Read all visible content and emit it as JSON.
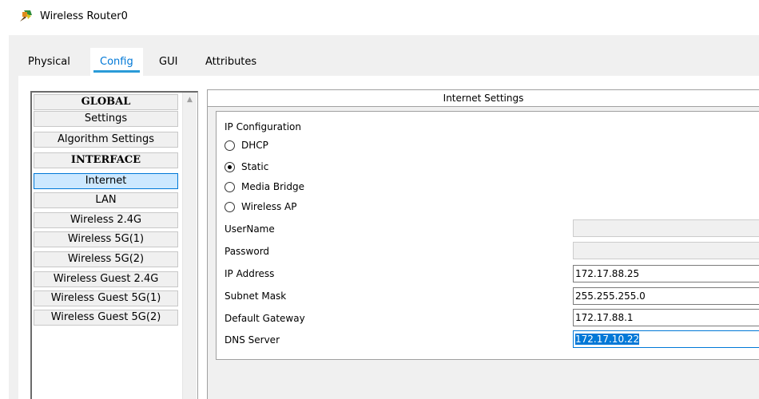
{
  "window": {
    "title": "Wireless Router0",
    "icon": "router-icon"
  },
  "tabs": [
    {
      "label": "Physical",
      "active": false
    },
    {
      "label": "Config",
      "active": true
    },
    {
      "label": "GUI",
      "active": false
    },
    {
      "label": "Attributes",
      "active": false
    }
  ],
  "nav": {
    "items": [
      {
        "label": "GLOBAL",
        "type": "header"
      },
      {
        "label": "Settings",
        "type": "item"
      },
      {
        "label": "Algorithm Settings",
        "type": "item"
      },
      {
        "label": "INTERFACE",
        "type": "header"
      },
      {
        "label": "Internet",
        "type": "item",
        "selected": true
      },
      {
        "label": "LAN",
        "type": "item"
      },
      {
        "label": "Wireless 2.4G",
        "type": "item"
      },
      {
        "label": "Wireless 5G(1)",
        "type": "item"
      },
      {
        "label": "Wireless 5G(2)",
        "type": "item"
      },
      {
        "label": "Wireless Guest 2.4G",
        "type": "item"
      },
      {
        "label": "Wireless Guest 5G(1)",
        "type": "item"
      },
      {
        "label": "Wireless Guest 5G(2)",
        "type": "item"
      }
    ]
  },
  "panel": {
    "title": "Internet Settings",
    "ip_config_label": "IP Configuration",
    "options": [
      {
        "label": "DHCP",
        "checked": false
      },
      {
        "label": "Static",
        "checked": true
      },
      {
        "label": "Media Bridge",
        "checked": false
      },
      {
        "label": "Wireless AP",
        "checked": false
      }
    ],
    "fields": {
      "username": {
        "label": "UserName",
        "value": ""
      },
      "password": {
        "label": "Password",
        "value": ""
      },
      "ip_address": {
        "label": "IP Address",
        "value": "172.17.88.25"
      },
      "subnet_mask": {
        "label": "Subnet Mask",
        "value": "255.255.255.0"
      },
      "default_gateway": {
        "label": "Default Gateway",
        "value": "172.17.88.1"
      },
      "dns_server": {
        "label": "DNS Server",
        "value": "172.17.10.22"
      }
    }
  },
  "colors": {
    "accent": "#0078d7",
    "tab_underline": "#2a9bd8",
    "selection_bg": "#cce8ff"
  }
}
